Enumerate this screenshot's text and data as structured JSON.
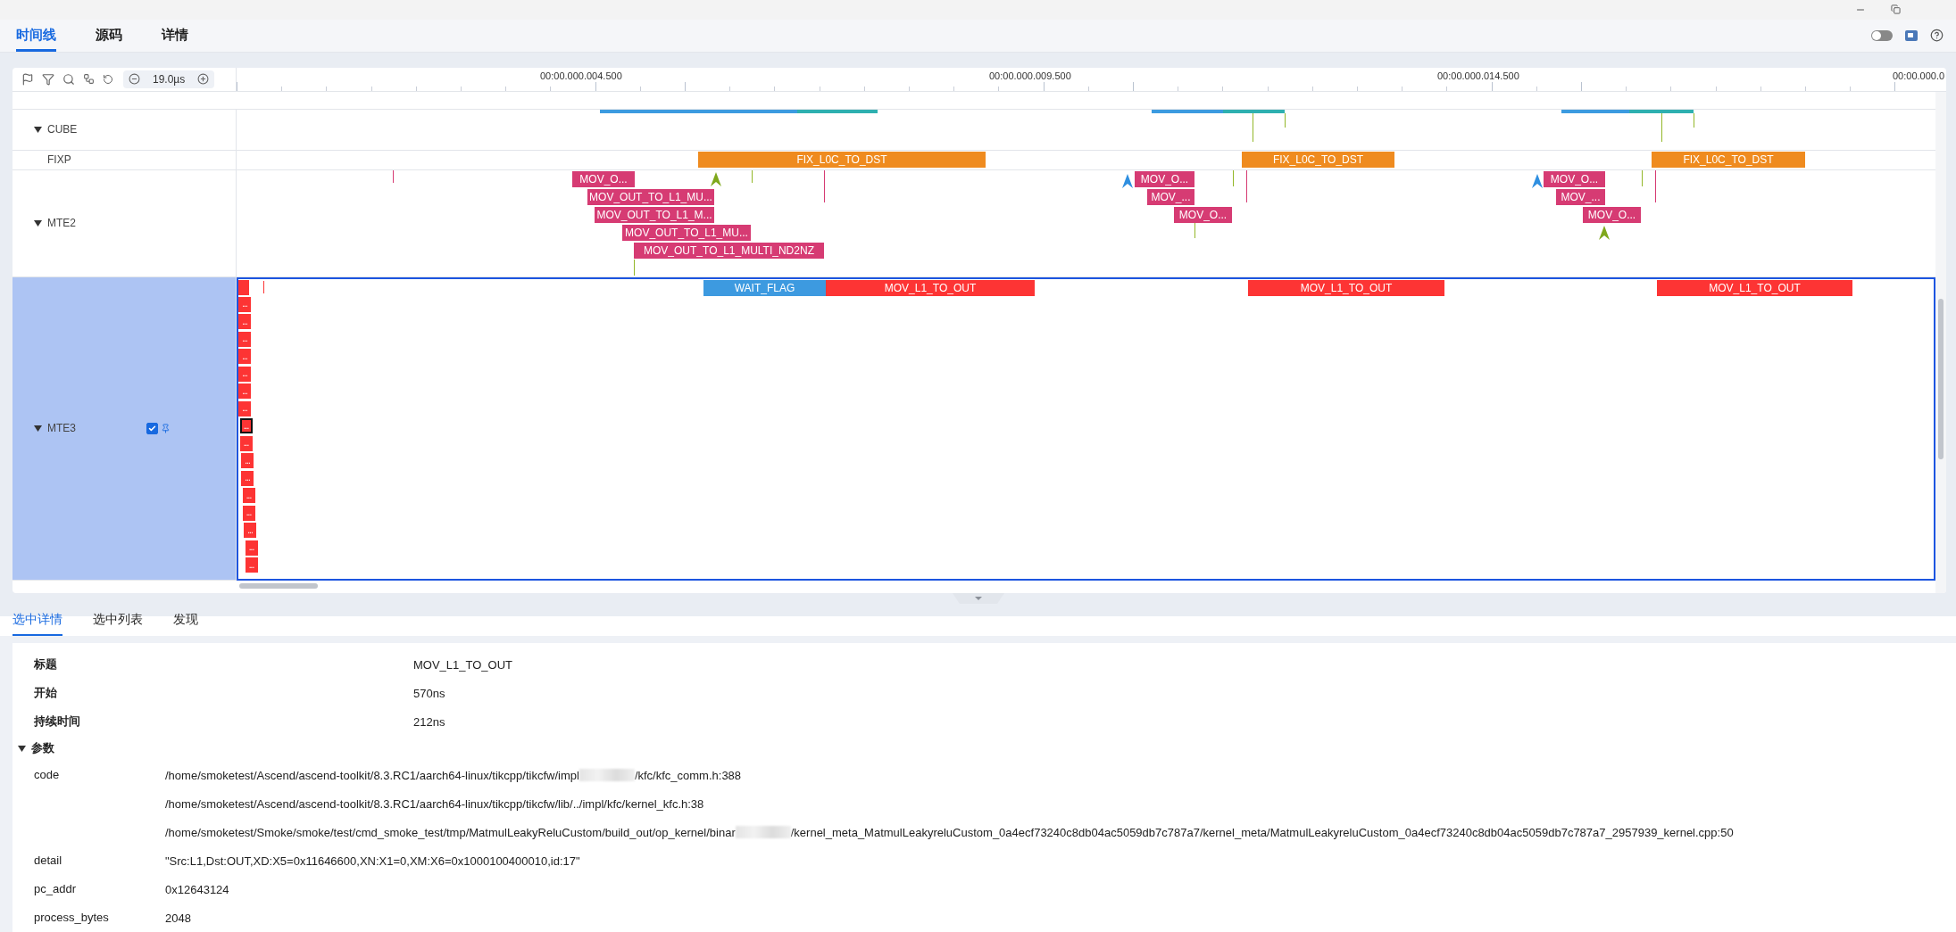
{
  "tabs": [
    {
      "label": "时间线",
      "selected": true
    },
    {
      "label": "源码",
      "selected": false
    },
    {
      "label": "详情",
      "selected": false
    }
  ],
  "theme_toggle": {
    "on": false
  },
  "toolbar": {
    "zoom_value": "19.0µs"
  },
  "ruler": {
    "labels": [
      "00:00.000.004.500",
      "00:00.000.009.500",
      "00:00.000.014.500",
      "00:00.000.0"
    ]
  },
  "lanes": [
    {
      "name": "CUBE",
      "expanded": true,
      "selected": false
    },
    {
      "name": "FIXP",
      "expanded": false,
      "selected": false,
      "events": [
        {
          "label": "FIX_L0C_TO_DST",
          "kind": "fix",
          "selected": false
        },
        {
          "label": "FIX_L0C_TO_DST",
          "kind": "fix",
          "selected": false
        },
        {
          "label": "FIX_L0C_TO_DST",
          "kind": "fix",
          "selected": false
        }
      ]
    },
    {
      "name": "MTE2",
      "expanded": true,
      "selected": false,
      "events": [
        {
          "label": "MOV_O...",
          "kind": "mte2",
          "selected": false
        },
        {
          "label": "MOV_OUT_TO_L1_MU...",
          "kind": "mte2",
          "selected": false
        },
        {
          "label": "MOV_OUT_TO_L1_M...",
          "kind": "mte2",
          "selected": false
        },
        {
          "label": "MOV_OUT_TO_L1_MU...",
          "kind": "mte2",
          "selected": false
        },
        {
          "label": "MOV_OUT_TO_L1_MULTI_ND2NZ",
          "kind": "mte2",
          "selected": false
        },
        {
          "label": "MOV_O...",
          "kind": "mte2",
          "selected": false
        },
        {
          "label": "MOV_...",
          "kind": "mte2",
          "selected": false
        },
        {
          "label": "MOV_O...",
          "kind": "mte2",
          "selected": false
        },
        {
          "label": "MOV_O...",
          "kind": "mte2",
          "selected": false
        },
        {
          "label": "MOV_...",
          "kind": "mte2",
          "selected": false
        },
        {
          "label": "MOV_O...",
          "kind": "mte2",
          "selected": false
        }
      ]
    },
    {
      "name": "MTE3",
      "expanded": true,
      "selected": true,
      "checked": true,
      "events": [
        {
          "label": "WAIT_FLAG",
          "kind": "wait",
          "selected": false
        },
        {
          "label": "MOV_L1_TO_OUT",
          "kind": "mte3",
          "selected": false
        },
        {
          "label": "MOV_L1_TO_OUT",
          "kind": "mte3",
          "selected": false
        },
        {
          "label": "MOV_L1_TO_OUT",
          "kind": "mte3",
          "selected": false
        },
        {
          "label": "...",
          "kind": "stack",
          "selected": false
        },
        {
          "label": "...",
          "kind": "stack",
          "selected": false
        },
        {
          "label": "...",
          "kind": "stack",
          "selected": false
        },
        {
          "label": "...",
          "kind": "stack",
          "selected": false
        },
        {
          "label": "...",
          "kind": "stack",
          "selected": false
        },
        {
          "label": "...",
          "kind": "stack",
          "selected": false
        },
        {
          "label": "...",
          "kind": "stack",
          "selected": false
        },
        {
          "label": "...",
          "kind": "stack",
          "selected": true
        },
        {
          "label": "...",
          "kind": "stack",
          "selected": false
        },
        {
          "label": "...",
          "kind": "stack",
          "selected": false
        },
        {
          "label": "...",
          "kind": "stack",
          "selected": false
        },
        {
          "label": "...",
          "kind": "stack",
          "selected": false
        },
        {
          "label": "...",
          "kind": "stack",
          "selected": false
        },
        {
          "label": "...",
          "kind": "stack",
          "selected": false
        },
        {
          "label": "...",
          "kind": "stack",
          "selected": false
        },
        {
          "label": "...",
          "kind": "stack",
          "selected": false
        }
      ]
    }
  ],
  "details": {
    "tabs": [
      {
        "label": "选中详情",
        "selected": true
      },
      {
        "label": "选中列表",
        "selected": false
      },
      {
        "label": "发现",
        "selected": false
      }
    ],
    "fields": [
      {
        "label": "标题",
        "value": "MOV_L1_TO_OUT"
      },
      {
        "label": "开始",
        "value": "570ns"
      },
      {
        "label": "持续时间",
        "value": "212ns"
      }
    ],
    "params": {
      "label": "参数",
      "expanded": true,
      "rows": [
        {
          "label": "code",
          "lines": [
            {
              "parts": [
                "/home/smoketest/Ascend/ascend-toolkit/8.3.RC1/aarch64-linux/tikcpp/tikcfw/impl",
                "/kfc/kfc_comm.h:388"
              ]
            },
            {
              "parts": [
                "/home/smoketest/Ascend/ascend-toolkit/8.3.RC1/aarch64-linux/tikcpp/tikcfw/lib/../impl/kfc/kernel_kfc.h:38"
              ]
            },
            {
              "parts": [
                "/home/smoketest/Smoke/smoke/test/cmd_smoke_test/tmp/MatmulLeakyReluCustom/build_out/op_kernel/binar",
                "/kernel_meta_MatmulLeakyreluCustom_0a4ecf73240c8db04ac5059db7c787a7/kernel_meta/MatmulLeakyreluCustom_0a4ecf73240c8db04ac5059db7c787a7_2957939_kernel.cpp:50"
              ]
            }
          ]
        },
        {
          "label": "detail",
          "lines": [
            {
              "parts": [
                "\"Src:L1,Dst:OUT,XD:X5=0x11646600,XN:X1=0,XM:X6=0x1000100400010,id:17\""
              ]
            }
          ]
        },
        {
          "label": "pc_addr",
          "lines": [
            {
              "parts": [
                "0x12643124"
              ]
            }
          ]
        },
        {
          "label": "process_bytes",
          "lines": [
            {
              "parts": [
                "2048"
              ]
            }
          ]
        }
      ]
    }
  }
}
